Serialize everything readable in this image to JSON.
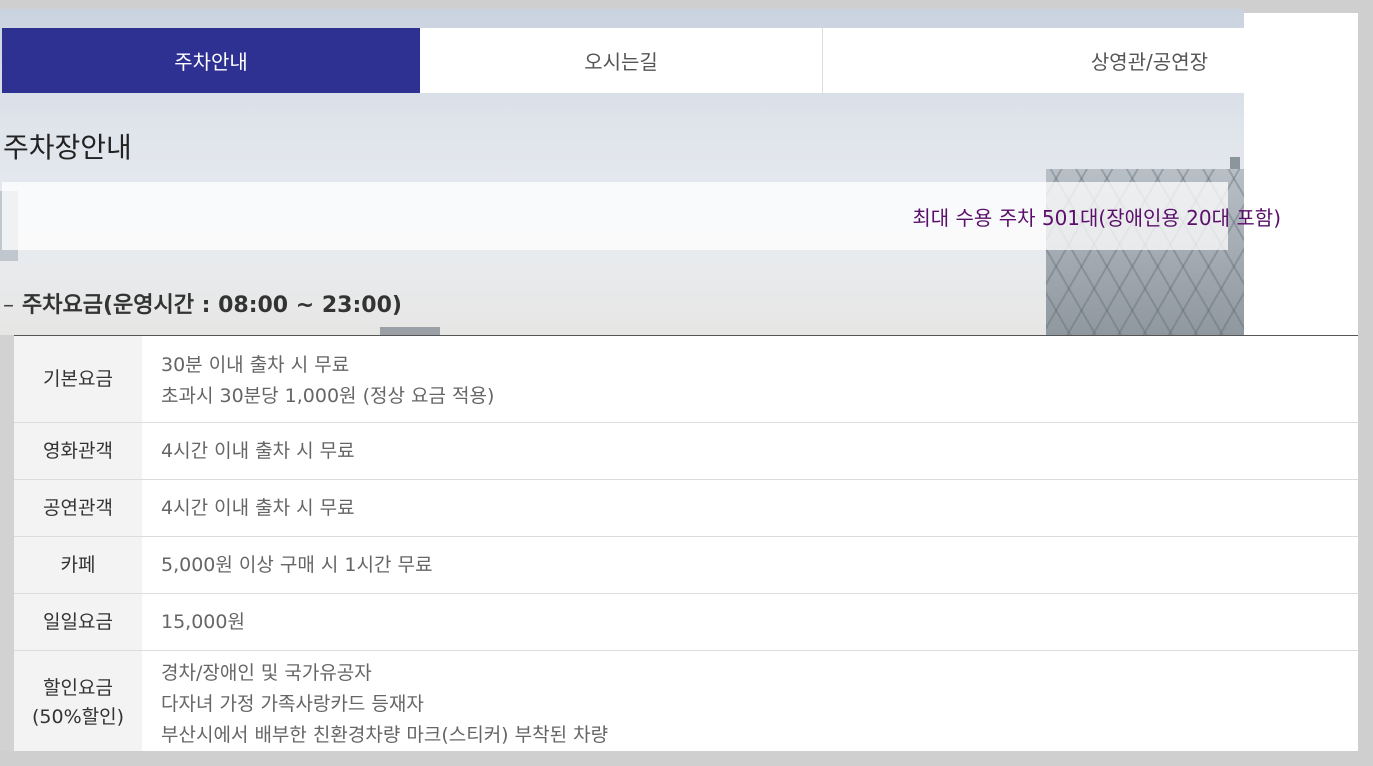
{
  "tabs": [
    {
      "label": "주차안내",
      "active": true
    },
    {
      "label": "오시는길",
      "active": false
    },
    {
      "label": "상영관/공연장",
      "active": false
    }
  ],
  "page_title": "주차장안내",
  "capacity_text": "최대 수용 주차 501대(장애인용 20대 포함)",
  "fee_heading": {
    "dash": "–",
    "text": "주차요금(운영시간 : 08:00 ~ 23:00)"
  },
  "fee_table": [
    {
      "label": "기본요금",
      "lines": [
        "30분 이내 출차 시 무료",
        "초과시 30분당 1,000원 (정상 요금 적용)"
      ]
    },
    {
      "label": "영화관객",
      "lines": [
        "4시간 이내 출차 시 무료"
      ]
    },
    {
      "label": "공연관객",
      "lines": [
        "4시간 이내 출차 시 무료"
      ]
    },
    {
      "label": "카페",
      "lines": [
        "5,000원 이상 구매 시 1시간 무료"
      ]
    },
    {
      "label": "일일요금",
      "lines": [
        "15,000원"
      ]
    },
    {
      "label": "할인요금",
      "sublabel": "(50%할인)",
      "lines": [
        "경차/장애인 및 국가유공자",
        "다자녀 가정 가족사랑카드 등재자",
        "부산시에서 배부한 친환경차량 마크(스티커) 부착된 차량"
      ]
    }
  ],
  "colors": {
    "active_tab": "#2e3192",
    "capacity_text": "#5a0f6a"
  }
}
